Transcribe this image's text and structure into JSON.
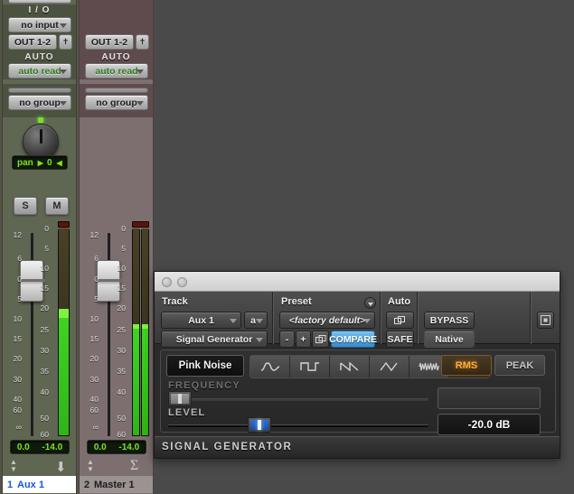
{
  "mixer": {
    "channels": [
      {
        "io_header": "I / O",
        "input": "no input",
        "output": "OUT 1-2",
        "auto_header": "AUTO",
        "auto_mode": "auto read",
        "group": "no group",
        "pan_label": "pan",
        "pan_value": "0",
        "solo": "S",
        "mute": "M",
        "fader_value": "0.0",
        "meter_value": "-14.0",
        "number": "1",
        "name": "Aux 1",
        "selected": true,
        "type_icon": "down-arrow-icon",
        "fader_scale": [
          "12",
          "6",
          "0",
          "5",
          "10",
          "15",
          "20",
          "30",
          "40",
          "60",
          "∞"
        ],
        "meter_scale": [
          "0",
          "5",
          "10",
          "15",
          "20",
          "25",
          "30",
          "35",
          "40",
          "50",
          "60"
        ]
      },
      {
        "io_header": "",
        "input": "",
        "output": "OUT 1-2",
        "auto_header": "AUTO",
        "auto_mode": "auto read",
        "group": "no group",
        "pan_label": "",
        "pan_value": "",
        "solo": "",
        "mute": "",
        "fader_value": "0.0",
        "meter_value": "-14.0",
        "number": "2",
        "name": "Master 1",
        "selected": false,
        "type_icon": "sigma-icon",
        "fader_scale": [
          "12",
          "6",
          "0",
          "5",
          "10",
          "15",
          "20",
          "30",
          "40",
          "60",
          "∞"
        ],
        "meter_scale": [
          "0",
          "5",
          "10",
          "15",
          "20",
          "25",
          "30",
          "35",
          "40",
          "50",
          "60"
        ]
      }
    ]
  },
  "plugin": {
    "window_buttons": [
      "close-button",
      "minimize-button"
    ],
    "columns": {
      "track_header": "Track",
      "preset_header": "Preset",
      "auto_header": "Auto"
    },
    "track_name": "Aux 1",
    "track_letter": "a",
    "plugin_name": "Signal Generator",
    "preset_name": "<factory default>",
    "preset_minus": "-",
    "preset_plus": "+",
    "compare": "COMPARE",
    "safe": "SAFE",
    "bypass": "BYPASS",
    "native": "Native",
    "generator": {
      "noise_label": "Pink Noise",
      "waveforms": [
        {
          "name": "sine-wave-icon",
          "active": false
        },
        {
          "name": "square-wave-icon",
          "active": false
        },
        {
          "name": "sawtooth-wave-icon",
          "active": false
        },
        {
          "name": "triangle-wave-icon",
          "active": false
        },
        {
          "name": "white-noise-icon",
          "active": false
        },
        {
          "name": "pink-noise-icon",
          "active": true
        }
      ],
      "rms_label": "RMS",
      "peak_label": "PEAK",
      "rms_active": true,
      "frequency_label": "FREQUENCY",
      "frequency_value": "",
      "level_label": "LEVEL",
      "level_value": "-20.0 dB"
    },
    "footer_title": "SIGNAL GENERATOR"
  },
  "colors": {
    "accent_blue": "#4d9fdb",
    "accent_orange": "#ffae42",
    "meter_green": "#3fd420",
    "lcd_green": "#7ee31e",
    "select_blue": "#1557e0"
  }
}
